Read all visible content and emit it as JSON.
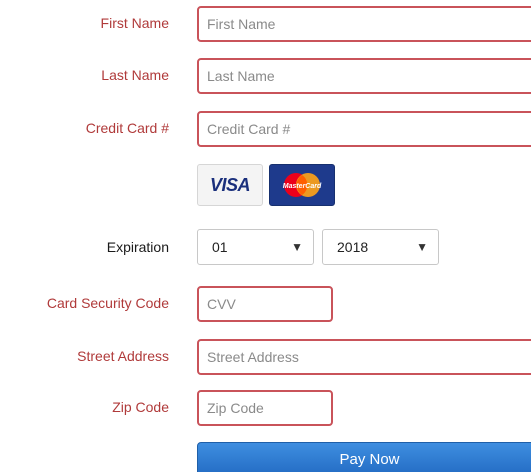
{
  "form": {
    "first_name": {
      "label": "First Name",
      "placeholder": "First Name",
      "value": ""
    },
    "last_name": {
      "label": "Last Name",
      "placeholder": "Last Name",
      "value": ""
    },
    "credit_card": {
      "label": "Credit Card #",
      "placeholder": "Credit Card #",
      "value": ""
    },
    "card_brands": {
      "visa": "VISA",
      "mastercard": "MasterCard"
    },
    "expiration": {
      "label": "Expiration",
      "month": "01",
      "year": "2018"
    },
    "cvv": {
      "label": "Card Security Code",
      "placeholder": "CVV",
      "value": ""
    },
    "street": {
      "label": "Street Address",
      "placeholder": "Street Address",
      "value": ""
    },
    "zip": {
      "label": "Zip Code",
      "placeholder": "Zip Code",
      "value": ""
    },
    "submit_label": "Pay Now"
  },
  "colors": {
    "label": "#b03a3a",
    "input_border": "#c9535a",
    "button": "#2a76cc",
    "mastercard_red": "#eb001b",
    "mastercard_yellow": "#f79e1b",
    "mastercard_bg": "#1e3a8c"
  },
  "icons": {
    "visa": "visa-card-icon",
    "mastercard": "mastercard-icon",
    "dropdown": "chevron-down-icon"
  }
}
